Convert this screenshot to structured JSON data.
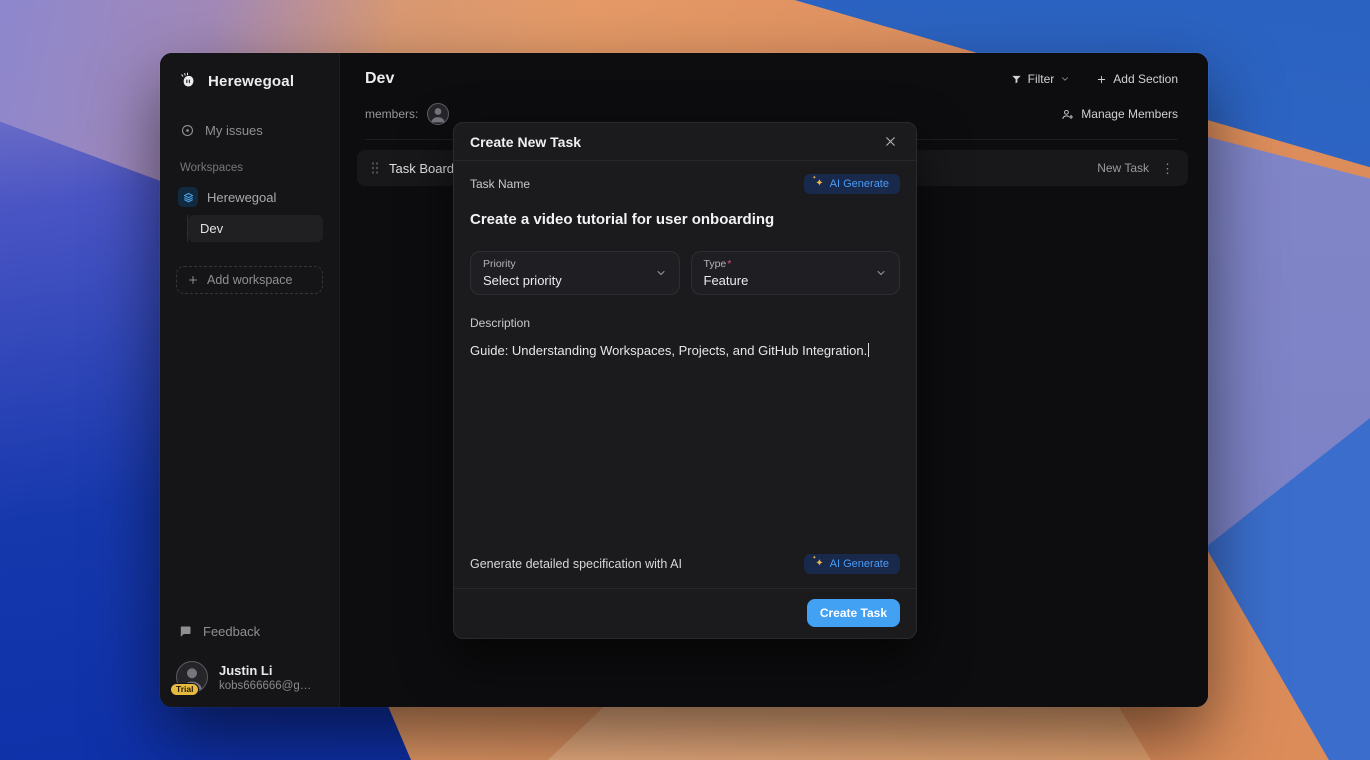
{
  "app": {
    "name": "Herewegoal"
  },
  "sidebar": {
    "my_issues_label": "My issues",
    "workspaces_label": "Workspaces",
    "workspace_name": "Herewegoal",
    "project_name": "Dev",
    "add_workspace_label": "Add workspace",
    "feedback_label": "Feedback",
    "user": {
      "name": "Justin Li",
      "email": "kobs666666@gmail....",
      "badge": "Trial"
    }
  },
  "header": {
    "title": "Dev",
    "members_label": "members:",
    "filter_label": "Filter",
    "add_section_label": "Add Section",
    "manage_members_label": "Manage Members"
  },
  "board": {
    "section_title": "Task Board",
    "new_task_label": "New Task"
  },
  "modal": {
    "title": "Create New Task",
    "task_name_label": "Task Name",
    "ai_generate_label": "AI Generate",
    "task_name_value": "Create a video tutorial for user onboarding",
    "priority_label": "Priority",
    "priority_value": "Select priority",
    "type_label": "Type",
    "type_required_mark": "*",
    "type_value": "Feature",
    "description_label": "Description",
    "description_value": "Guide: Understanding Workspaces, Projects, and GitHub Integration.",
    "spec_hint": "Generate detailed specification with AI",
    "spec_ai_generate_label": "AI Generate",
    "create_task_label": "Create Task"
  },
  "icons": {
    "sparkle_glyph": "✦",
    "kebab_glyph": "⋮"
  },
  "colors": {
    "accent_blue": "#43a1f3",
    "ai_pill_bg": "#18294b",
    "ai_pill_text": "#4b9bf5",
    "sparkle_gold": "#edb74a",
    "trial_badge": "#e6b93f",
    "workspace_icon": "#4aa3e8",
    "required_asterisk": "#ef476f"
  }
}
